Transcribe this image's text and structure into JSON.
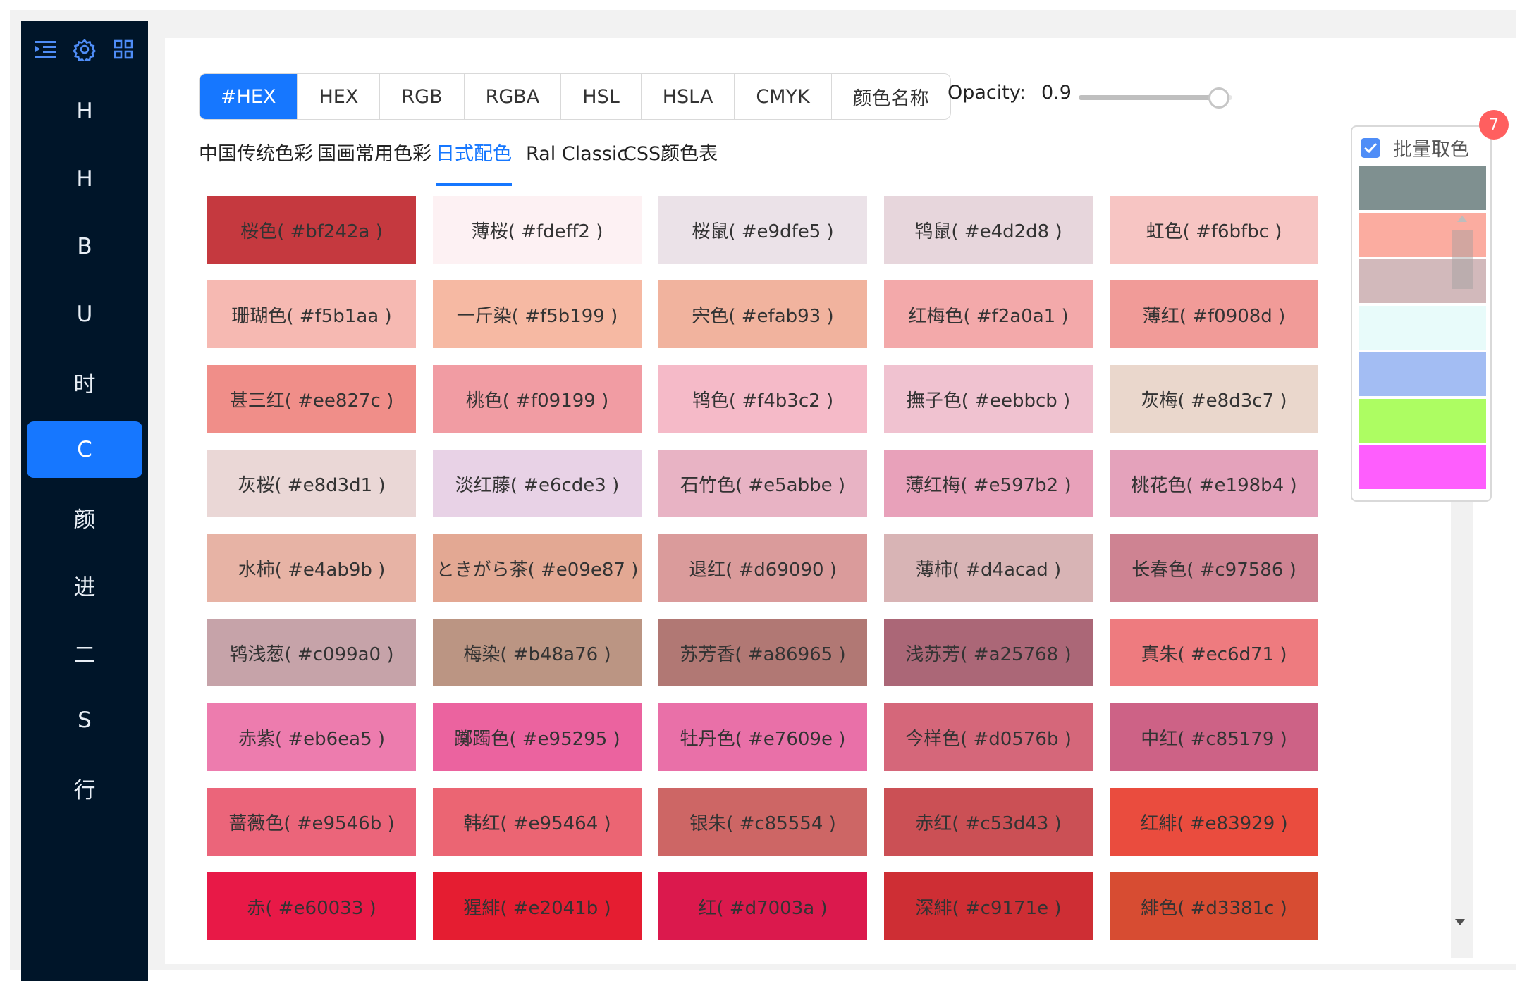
{
  "sidebar": {
    "top_icons": [
      "menu-icon",
      "gear-icon",
      "grid-icon"
    ],
    "items": [
      {
        "label": "H",
        "active": false
      },
      {
        "label": "H",
        "active": false
      },
      {
        "label": "B",
        "active": false
      },
      {
        "label": "U",
        "active": false
      },
      {
        "label": "时",
        "active": false
      },
      {
        "label": "C",
        "active": true
      },
      {
        "label": "颜",
        "active": false
      },
      {
        "label": "进",
        "active": false
      },
      {
        "label": "二",
        "active": false
      },
      {
        "label": "S",
        "active": false
      },
      {
        "label": "行",
        "active": false
      }
    ]
  },
  "formats": {
    "buttons": [
      "#HEX",
      "HEX",
      "RGB",
      "RGBA",
      "HSL",
      "HSLA",
      "CMYK",
      "颜色名称"
    ],
    "active_index": 0
  },
  "opacity": {
    "label": "Opacity:",
    "value": "0.9",
    "level": 0.9
  },
  "tabs": {
    "items": [
      "中国传统色彩",
      "国画常用色彩",
      "日式配色",
      "Ral Classic",
      "CSS颜色表"
    ],
    "active_index": 2
  },
  "colors": [
    {
      "name": "桜色",
      "hex": "#bf242a"
    },
    {
      "name": "薄桜",
      "hex": "#fdeff2"
    },
    {
      "name": "桜鼠",
      "hex": "#e9dfe5"
    },
    {
      "name": "鸨鼠",
      "hex": "#e4d2d8"
    },
    {
      "name": "虹色",
      "hex": "#f6bfbc"
    },
    {
      "name": "珊瑚色",
      "hex": "#f5b1aa"
    },
    {
      "name": "一斤染",
      "hex": "#f5b199"
    },
    {
      "name": "宍色",
      "hex": "#efab93"
    },
    {
      "name": "红梅色",
      "hex": "#f2a0a1"
    },
    {
      "name": "薄红",
      "hex": "#f0908d"
    },
    {
      "name": "甚三红",
      "hex": "#ee827c"
    },
    {
      "name": "桃色",
      "hex": "#f09199"
    },
    {
      "name": "鸨色",
      "hex": "#f4b3c2"
    },
    {
      "name": "撫子色",
      "hex": "#eebbcb"
    },
    {
      "name": "灰梅",
      "hex": "#e8d3c7"
    },
    {
      "name": "灰桜",
      "hex": "#e8d3d1"
    },
    {
      "name": "淡红藤",
      "hex": "#e6cde3"
    },
    {
      "name": "石竹色",
      "hex": "#e5abbe"
    },
    {
      "name": "薄红梅",
      "hex": "#e597b2"
    },
    {
      "name": "桃花色",
      "hex": "#e198b4"
    },
    {
      "name": "水柿",
      "hex": "#e4ab9b"
    },
    {
      "name": "ときがら茶",
      "hex": "#e09e87"
    },
    {
      "name": "退红",
      "hex": "#d69090"
    },
    {
      "name": "薄柿",
      "hex": "#d4acad"
    },
    {
      "name": "长春色",
      "hex": "#c97586"
    },
    {
      "name": "鸨浅葱",
      "hex": "#c099a0"
    },
    {
      "name": "梅染",
      "hex": "#b48a76"
    },
    {
      "name": "苏芳香",
      "hex": "#a86965"
    },
    {
      "name": "浅苏芳",
      "hex": "#a25768"
    },
    {
      "name": "真朱",
      "hex": "#ec6d71"
    },
    {
      "name": "赤紫",
      "hex": "#eb6ea5"
    },
    {
      "name": "躑躅色",
      "hex": "#e95295"
    },
    {
      "name": "牡丹色",
      "hex": "#e7609e"
    },
    {
      "name": "今样色",
      "hex": "#d0576b"
    },
    {
      "name": "中红",
      "hex": "#c85179"
    },
    {
      "name": "蔷薇色",
      "hex": "#e9546b"
    },
    {
      "name": "韩红",
      "hex": "#e95464"
    },
    {
      "name": "银朱",
      "hex": "#c85554"
    },
    {
      "name": "赤红",
      "hex": "#c53d43"
    },
    {
      "name": "红緋",
      "hex": "#e83929"
    },
    {
      "name": "赤",
      "hex": "#e60033"
    },
    {
      "name": "猩緋",
      "hex": "#e2041b"
    },
    {
      "name": "红",
      "hex": "#d7003a"
    },
    {
      "name": "深緋",
      "hex": "#c9171e"
    },
    {
      "name": "緋色",
      "hex": "#d3381c"
    }
  ],
  "batch": {
    "label": "批量取色",
    "checked": true,
    "count": "7",
    "colors": [
      "#7f9090",
      "#fbaca0",
      "#d2b9bb",
      "#e8fbfa",
      "#a3bdf3",
      "#adfd62",
      "#fe5efd"
    ]
  },
  "theme": {
    "accent": "#1677ff",
    "sidebar_bg": "#001529",
    "badge": "#ff5f5f"
  }
}
